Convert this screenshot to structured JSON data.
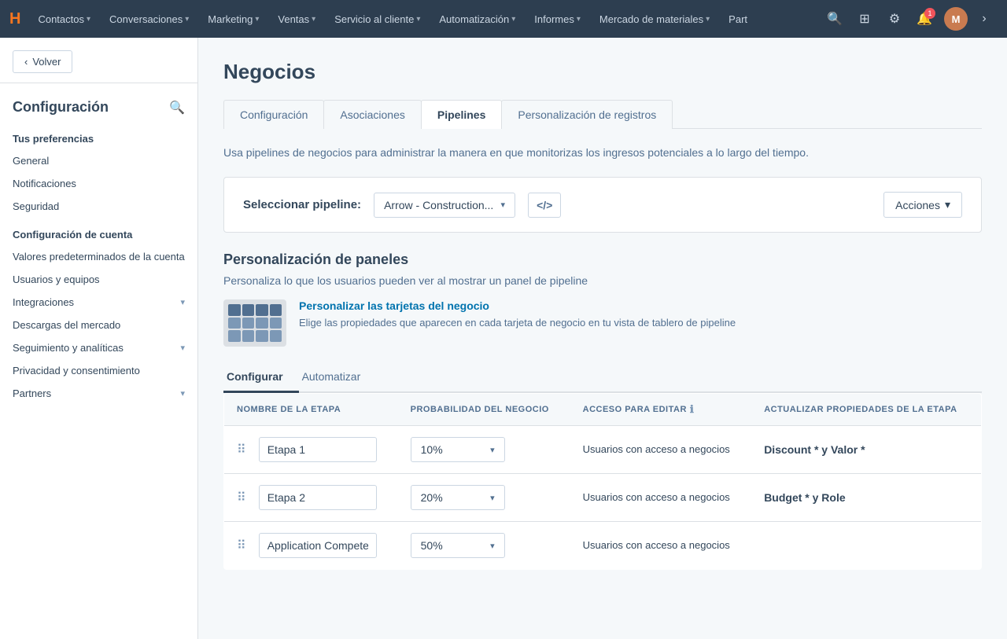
{
  "nav": {
    "logo": "H",
    "items": [
      {
        "label": "Contactos",
        "hasDropdown": true
      },
      {
        "label": "Conversaciones",
        "hasDropdown": true
      },
      {
        "label": "Marketing",
        "hasDropdown": true
      },
      {
        "label": "Ventas",
        "hasDropdown": true
      },
      {
        "label": "Servicio al cliente",
        "hasDropdown": true
      },
      {
        "label": "Automatización",
        "hasDropdown": true
      },
      {
        "label": "Informes",
        "hasDropdown": true
      },
      {
        "label": "Mercado de materiales",
        "hasDropdown": true
      },
      {
        "label": "Part",
        "hasDropdown": false
      }
    ],
    "notification_count": "1"
  },
  "sidebar": {
    "back_label": "Volver",
    "title": "Configuración",
    "sections": [
      {
        "title": "Tus preferencias",
        "items": [
          {
            "label": "General",
            "hasDropdown": false
          },
          {
            "label": "Notificaciones",
            "hasDropdown": false
          },
          {
            "label": "Seguridad",
            "hasDropdown": false
          }
        ]
      },
      {
        "title": "Configuración de cuenta",
        "items": [
          {
            "label": "Valores predeterminados de la cuenta",
            "hasDropdown": false
          },
          {
            "label": "Usuarios y equipos",
            "hasDropdown": false
          },
          {
            "label": "Integraciones",
            "hasDropdown": true
          },
          {
            "label": "Descargas del mercado",
            "hasDropdown": false
          },
          {
            "label": "Seguimiento y analíticas",
            "hasDropdown": true
          },
          {
            "label": "Privacidad y consentimiento",
            "hasDropdown": false
          },
          {
            "label": "Partners",
            "hasDropdown": true
          }
        ]
      }
    ]
  },
  "main": {
    "page_title": "Negocios",
    "tabs": [
      {
        "label": "Configuración",
        "active": false
      },
      {
        "label": "Asociaciones",
        "active": false
      },
      {
        "label": "Pipelines",
        "active": true
      },
      {
        "label": "Personalización de registros",
        "active": false
      }
    ],
    "description": "Usa pipelines de negocios para administrar la manera en que monitorizas los ingresos potenciales a lo largo del tiempo.",
    "pipeline_selector": {
      "label": "Seleccionar pipeline:",
      "selected": "Arrow - Construction...",
      "acciones_label": "Acciones"
    },
    "personalizacion": {
      "title": "Personalización de paneles",
      "desc": "Personaliza lo que los usuarios pueden ver al mostrar un panel de pipeline",
      "card_link": "Personalizar las tarjetas del negocio",
      "card_desc": "Elige las propiedades que aparecen en cada tarjeta de negocio en tu vista de tablero de pipeline"
    },
    "sub_tabs": [
      {
        "label": "Configurar",
        "active": true
      },
      {
        "label": "Automatizar",
        "active": false
      }
    ],
    "table": {
      "columns": [
        {
          "label": "NOMBRE DE LA ETAPA"
        },
        {
          "label": "PROBABILIDAD DEL NEGOCIO"
        },
        {
          "label": "ACCESO PARA EDITAR",
          "hasInfo": true
        },
        {
          "label": "ACTUALIZAR PROPIEDADES DE LA ETAPA"
        }
      ],
      "rows": [
        {
          "name": "Etapa 1",
          "probability": "10%",
          "access": "Usuarios con acceso a negocios",
          "properties": "Discount * y Valor *"
        },
        {
          "name": "Etapa 2",
          "probability": "20%",
          "access": "Usuarios con acceso a negocios",
          "properties": "Budget * y Role"
        },
        {
          "name": "Application Compete",
          "probability": "50%",
          "access": "Usuarios con acceso a negocios",
          "properties": ""
        }
      ]
    }
  }
}
